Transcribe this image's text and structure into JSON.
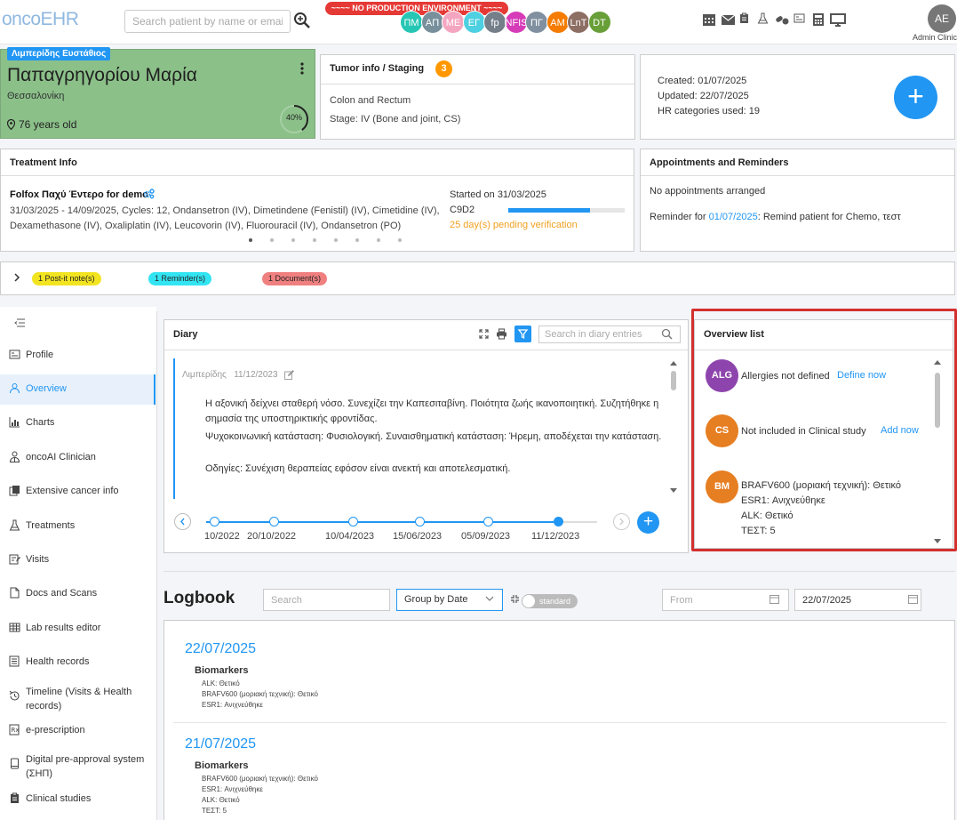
{
  "app": {
    "logo": "oncoEHR",
    "search_placeholder": "Search patient by name or email",
    "environment_badge": "~~~~ NO PRODUCTION ENVIRONMENT ~~~~",
    "user_initials": "ΑΕ",
    "user_name": "Admin Clinic",
    "chips": [
      {
        "label": "ΠΜ",
        "color": "#26c6b4"
      },
      {
        "label": "ΑΠ",
        "color": "#78909c"
      },
      {
        "label": "ΜΕ",
        "color": "#f4a6c0"
      },
      {
        "label": "ΕΓ",
        "color": "#4dd0e1"
      },
      {
        "label": "fp",
        "color": "#757f8a"
      },
      {
        "label": "NFIS",
        "color": "#d63bb8"
      },
      {
        "label": "ΠΓ",
        "color": "#8090a0"
      },
      {
        "label": "ΑΜ",
        "color": "#f57c00"
      },
      {
        "label": "LnT",
        "color": "#8d6e63"
      },
      {
        "label": "DT",
        "color": "#689f38"
      }
    ],
    "toolbar_icons": [
      "calendar-icon",
      "mail-icon",
      "clipboard-icon",
      "flask-icon",
      "pills-icon",
      "id-card-icon",
      "calculator-icon",
      "monitor-icon"
    ]
  },
  "patient": {
    "doctor": "Λιμπερίδης Ευστάθιος",
    "name": "Παπαγρηγορίου Μαρία",
    "city": "Θεσσαλονίκη",
    "age": "76 years old",
    "completion_percent": 40,
    "completion_label": "40%"
  },
  "tumor": {
    "title": "Tumor info / Staging",
    "count": "3",
    "site": "Colon and Rectum",
    "stage": "Stage: IV (Bone and joint, CS)"
  },
  "meta": {
    "created": "Created: 01/07/2025",
    "updated": "Updated: 22/07/2025",
    "hr_categories": "HR categories used: 19"
  },
  "treatment": {
    "title": "Treatment Info",
    "name": "Folfox Παχύ Έντερο for demo",
    "description": "31/03/2025 - 14/09/2025, Cycles: 12, Ondansetron (IV), Dimetindene (Fenistil) (IV), Cimetidine (IV), Dexamethasone (IV), Oxaliplatin (IV), Leucovorin (IV), Fluorouracil (IV), Ondansetron (PO)",
    "started": "Started on 31/03/2025",
    "code": "C9D2",
    "progress": 0.7,
    "pending": "25 day(s) pending verification",
    "pages": 8,
    "active_page": 0
  },
  "appointments": {
    "title": "Appointments and Reminders",
    "none": "No appointments arranged",
    "reminder_prefix": "Reminder for ",
    "reminder_date": "01/07/2025",
    "reminder_suffix": ": Remind patient for Chemo, τεστ"
  },
  "notes": {
    "postit": {
      "label": "1 Post-it note(s)",
      "color": "#f2e421"
    },
    "reminder": {
      "label": "1 Reminder(s)",
      "color": "#33e4f2"
    },
    "document": {
      "label": "1 Document(s)",
      "color": "#f08080"
    }
  },
  "sidebar": {
    "items": [
      {
        "label": "Profile",
        "icon": "id-card-icon"
      },
      {
        "label": "Overview",
        "icon": "person-icon",
        "active": true
      },
      {
        "label": "Charts",
        "icon": "chart-icon"
      },
      {
        "label": "oncoAI Clinician",
        "icon": "doctor-icon"
      },
      {
        "label": "Extensive cancer info",
        "icon": "document-icon"
      },
      {
        "label": "Treatments",
        "icon": "flask-icon"
      },
      {
        "label": "Visits",
        "icon": "edit-icon"
      },
      {
        "label": "Docs and Scans",
        "icon": "file-icon"
      },
      {
        "label": "Lab results editor",
        "icon": "table-icon"
      },
      {
        "label": "Health records",
        "icon": "list-icon"
      },
      {
        "label": "Timeline (Visits & Health records)",
        "icon": "history-icon"
      },
      {
        "label": "e-prescription",
        "icon": "prescription-icon"
      },
      {
        "label": "Digital pre-approval system (ΣΗΠ)",
        "icon": "phone-icon"
      },
      {
        "label": "Clinical studies",
        "icon": "clipboard-icon"
      }
    ]
  },
  "diary": {
    "title": "Diary",
    "search_placeholder": "Search in diary entries",
    "author": "Λιμπερίδης",
    "date": "11/12/2023",
    "paragraphs": [
      "Η αξονική δείχνει σταθερή νόσο. Συνεχίζει την Καπεσιταβίνη. Ποιότητα ζωής ικανοποιητική. Συζητήθηκε η σημασία της υποστηρικτικής φροντίδας.",
      "Ψυχοκοινωνική κατάσταση: Φυσιολογική. Συναισθηματική κατάσταση: Ήρεμη, αποδέχεται την κατάσταση.",
      "Οδηγίες: Συνέχιση θεραπείας εφόσον είναι ανεκτή και αποτελεσματική."
    ],
    "timeline": [
      "10/2022",
      "20/10/2022",
      "10/04/2023",
      "15/06/2023",
      "05/09/2023",
      "11/12/2023"
    ]
  },
  "overview": {
    "title": "Overview list",
    "items": [
      {
        "initials": "ALG",
        "color": "#8e44ad",
        "lines": [
          "Allergies not defined"
        ],
        "link": "Define now"
      },
      {
        "initials": "CS",
        "color": "#e67e22",
        "lines": [
          "Not included in Clinical study"
        ],
        "link": "Add now"
      },
      {
        "initials": "BM",
        "color": "#e67e22",
        "lines": [
          "BRAFV600 (μοριακή τεχνική): Θετικό",
          "ESR1: Ανιχνεύθηκε",
          "ALK: Θετικό",
          "ΤΕΣΤ: 5"
        ],
        "link": ""
      }
    ]
  },
  "logbook": {
    "title": "Logbook",
    "search_placeholder": "Search",
    "group_by": "Group by Date",
    "toggle_label": "standard",
    "from_placeholder": "From",
    "to_value": "22/07/2025",
    "days": [
      {
        "date": "22/07/2025",
        "category": "Biomarkers",
        "rows": [
          "ALK: Θετικό",
          "BRAFV600 (μοριακή τεχνική): Θετικό",
          "ESR1: Ανιχνεύθηκε"
        ]
      },
      {
        "date": "21/07/2025",
        "category": "Biomarkers",
        "rows": [
          "BRAFV600 (μοριακή τεχνική): Θετικό",
          "ESR1: Ανιχνεύθηκε",
          "ALK: Θετικό",
          "ΤΕΣΤ: 5"
        ]
      }
    ]
  }
}
